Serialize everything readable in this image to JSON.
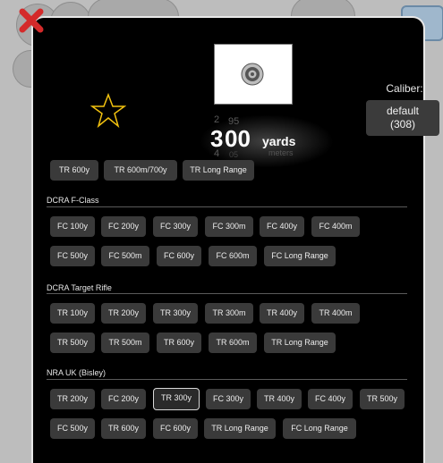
{
  "dialog": {
    "caliber_label": "Caliber:",
    "caliber_value_line1": "default",
    "caliber_value_line2": "(308)"
  },
  "distance": {
    "value": "300",
    "value_hundreds": "3",
    "value_rest": "00",
    "unit": "yards",
    "alt_unit": "meters",
    "above_1": "2",
    "above_2": "95",
    "below_1": "4",
    "below_2": "05"
  },
  "rows": [
    {
      "chips": [
        "TR 600y",
        "TR 600m/700y",
        "TR Long Range"
      ]
    }
  ],
  "sections": [
    {
      "title": "DCRA F-Class",
      "rows": [
        [
          "FC 100y",
          "FC 200y",
          "FC 300y",
          "FC 300m",
          "FC 400y",
          "FC 400m"
        ],
        [
          "FC 500y",
          "FC 500m",
          "FC 600y",
          "FC 600m",
          "FC Long Range"
        ]
      ]
    },
    {
      "title": "DCRA Target Rifle",
      "rows": [
        [
          "TR 100y",
          "TR 200y",
          "TR 300y",
          "TR 300m",
          "TR 400y",
          "TR 400m"
        ],
        [
          "TR 500y",
          "TR 500m",
          "TR 600y",
          "TR 600m",
          "TR Long Range"
        ]
      ]
    },
    {
      "title": "NRA UK (Bisley)",
      "rows": [
        [
          "TR 200y",
          "FC 200y",
          "TR 300y",
          "FC 300y",
          "TR 400y",
          "FC 400y",
          "TR 500y"
        ],
        [
          "FC 500y",
          "TR 600y",
          "FC 600y",
          "TR Long Range",
          "FC Long Range"
        ]
      ]
    }
  ],
  "colors": {
    "dialog_bg": "#000000",
    "chip_bg": "#3a3a3a",
    "close_red": "#d42a2a"
  },
  "icons": [
    "close-icon",
    "target-icon",
    "star-icon"
  ]
}
